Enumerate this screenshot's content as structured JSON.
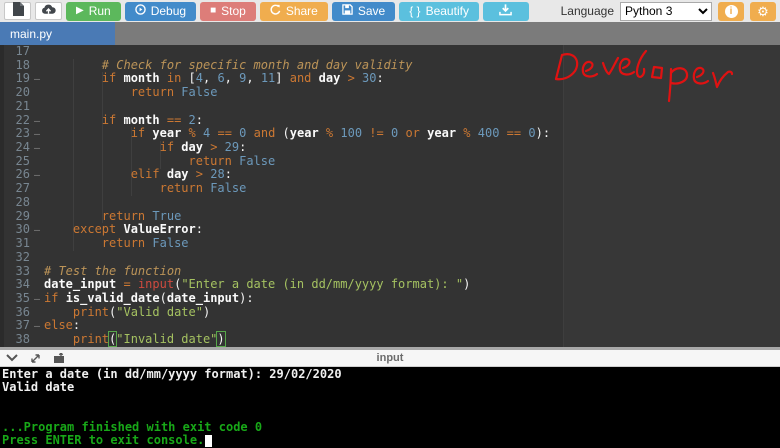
{
  "toolbar": {
    "run_label": "Run",
    "debug_label": "Debug",
    "stop_label": "Stop",
    "share_label": "Share",
    "save_label": "Save",
    "beautify_label": "Beautify",
    "beautify_icon": "{ }",
    "language_label": "Language",
    "language_value": "Python 3"
  },
  "tab": {
    "label": "main.py"
  },
  "annotation": {
    "text": "Developer",
    "color": "#e01212"
  },
  "colors": {
    "run": "#5cb85c",
    "debug": "#428bca",
    "stop": "#dd7d79",
    "share": "#f0ad4e",
    "save": "#428bca",
    "beautify": "#5bc0de",
    "accent_orange": "#f0ad4e",
    "editor_bg": "#333333",
    "keyword": "#cc7833",
    "string": "#a5c261",
    "number": "#6c99bb",
    "comment": "#bc9458",
    "console_green": "#18a818"
  },
  "editor": {
    "lines": [
      {
        "n": 17,
        "fold": false,
        "tokens": []
      },
      {
        "n": 18,
        "fold": false,
        "tokens": [
          [
            "com",
            "        # Check for specific month and day validity"
          ]
        ]
      },
      {
        "n": 19,
        "fold": true,
        "tokens": [
          [
            "sp",
            "        "
          ],
          [
            "kw",
            "if"
          ],
          [
            "sp",
            " "
          ],
          [
            "var",
            "month"
          ],
          [
            "sp",
            " "
          ],
          [
            "kw",
            "in"
          ],
          [
            "sp",
            " ["
          ],
          [
            "num",
            "4"
          ],
          [
            "sp",
            ", "
          ],
          [
            "num",
            "6"
          ],
          [
            "sp",
            ", "
          ],
          [
            "num",
            "9"
          ],
          [
            "sp",
            ", "
          ],
          [
            "num",
            "11"
          ],
          [
            "sp",
            "] "
          ],
          [
            "kw",
            "and"
          ],
          [
            "sp",
            " "
          ],
          [
            "var",
            "day"
          ],
          [
            "sp",
            " "
          ],
          [
            "kw",
            ">"
          ],
          [
            "sp",
            " "
          ],
          [
            "num",
            "30"
          ],
          [
            "sp",
            ":"
          ]
        ]
      },
      {
        "n": 20,
        "fold": false,
        "tokens": [
          [
            "sp",
            "            "
          ],
          [
            "kw",
            "return"
          ],
          [
            "sp",
            " "
          ],
          [
            "num",
            "False"
          ]
        ]
      },
      {
        "n": 21,
        "fold": false,
        "tokens": []
      },
      {
        "n": 22,
        "fold": true,
        "tokens": [
          [
            "sp",
            "        "
          ],
          [
            "kw",
            "if"
          ],
          [
            "sp",
            " "
          ],
          [
            "var",
            "month"
          ],
          [
            "sp",
            " "
          ],
          [
            "kw",
            "=="
          ],
          [
            "sp",
            " "
          ],
          [
            "num",
            "2"
          ],
          [
            "sp",
            ":"
          ]
        ]
      },
      {
        "n": 23,
        "fold": true,
        "tokens": [
          [
            "sp",
            "            "
          ],
          [
            "kw",
            "if"
          ],
          [
            "sp",
            " "
          ],
          [
            "var",
            "year"
          ],
          [
            "sp",
            " "
          ],
          [
            "kw",
            "%"
          ],
          [
            "sp",
            " "
          ],
          [
            "num",
            "4"
          ],
          [
            "sp",
            " "
          ],
          [
            "kw",
            "=="
          ],
          [
            "sp",
            " "
          ],
          [
            "num",
            "0"
          ],
          [
            "sp",
            " "
          ],
          [
            "kw",
            "and"
          ],
          [
            "sp",
            " ("
          ],
          [
            "var",
            "year"
          ],
          [
            "sp",
            " "
          ],
          [
            "kw",
            "%"
          ],
          [
            "sp",
            " "
          ],
          [
            "num",
            "100"
          ],
          [
            "sp",
            " "
          ],
          [
            "kw",
            "!="
          ],
          [
            "sp",
            " "
          ],
          [
            "num",
            "0"
          ],
          [
            "sp",
            " "
          ],
          [
            "kw",
            "or"
          ],
          [
            "sp",
            " "
          ],
          [
            "var",
            "year"
          ],
          [
            "sp",
            " "
          ],
          [
            "kw",
            "%"
          ],
          [
            "sp",
            " "
          ],
          [
            "num",
            "400"
          ],
          [
            "sp",
            " "
          ],
          [
            "kw",
            "=="
          ],
          [
            "sp",
            " "
          ],
          [
            "num",
            "0"
          ],
          [
            "sp",
            "):"
          ]
        ]
      },
      {
        "n": 24,
        "fold": true,
        "tokens": [
          [
            "sp",
            "                "
          ],
          [
            "kw",
            "if"
          ],
          [
            "sp",
            " "
          ],
          [
            "var",
            "day"
          ],
          [
            "sp",
            " "
          ],
          [
            "kw",
            ">"
          ],
          [
            "sp",
            " "
          ],
          [
            "num",
            "29"
          ],
          [
            "sp",
            ":"
          ]
        ]
      },
      {
        "n": 25,
        "fold": false,
        "tokens": [
          [
            "sp",
            "                    "
          ],
          [
            "kw",
            "return"
          ],
          [
            "sp",
            " "
          ],
          [
            "num",
            "False"
          ]
        ]
      },
      {
        "n": 26,
        "fold": true,
        "tokens": [
          [
            "sp",
            "            "
          ],
          [
            "kw",
            "elif"
          ],
          [
            "sp",
            " "
          ],
          [
            "var",
            "day"
          ],
          [
            "sp",
            " "
          ],
          [
            "kw",
            ">"
          ],
          [
            "sp",
            " "
          ],
          [
            "num",
            "28"
          ],
          [
            "sp",
            ":"
          ]
        ]
      },
      {
        "n": 27,
        "fold": false,
        "tokens": [
          [
            "sp",
            "                "
          ],
          [
            "kw",
            "return"
          ],
          [
            "sp",
            " "
          ],
          [
            "num",
            "False"
          ]
        ]
      },
      {
        "n": 28,
        "fold": false,
        "tokens": []
      },
      {
        "n": 29,
        "fold": false,
        "tokens": [
          [
            "sp",
            "        "
          ],
          [
            "kw",
            "return"
          ],
          [
            "sp",
            " "
          ],
          [
            "num",
            "True"
          ]
        ]
      },
      {
        "n": 30,
        "fold": true,
        "tokens": [
          [
            "sp",
            "    "
          ],
          [
            "kw",
            "except"
          ],
          [
            "sp",
            " "
          ],
          [
            "var",
            "ValueError"
          ],
          [
            "sp",
            ":"
          ]
        ]
      },
      {
        "n": 31,
        "fold": false,
        "tokens": [
          [
            "sp",
            "        "
          ],
          [
            "kw",
            "return"
          ],
          [
            "sp",
            " "
          ],
          [
            "num",
            "False"
          ]
        ]
      },
      {
        "n": 32,
        "fold": false,
        "tokens": []
      },
      {
        "n": 33,
        "fold": false,
        "tokens": [
          [
            "com",
            "# Test the function"
          ]
        ]
      },
      {
        "n": 34,
        "fold": false,
        "tokens": [
          [
            "var",
            "date_input"
          ],
          [
            "sp",
            " "
          ],
          [
            "kw",
            "="
          ],
          [
            "sp",
            " "
          ],
          [
            "fn",
            "input"
          ],
          [
            "sp",
            "("
          ],
          [
            "str",
            "\"Enter a date (in dd/mm/yyyy format): \""
          ],
          [
            "sp",
            ")"
          ]
        ]
      },
      {
        "n": 35,
        "fold": true,
        "tokens": [
          [
            "kw",
            "if"
          ],
          [
            "sp",
            " "
          ],
          [
            "var",
            "is_valid_date"
          ],
          [
            "sp",
            "("
          ],
          [
            "var",
            "date_input"
          ],
          [
            "sp",
            "):"
          ]
        ]
      },
      {
        "n": 36,
        "fold": false,
        "tokens": [
          [
            "sp",
            "    "
          ],
          [
            "kw",
            "print"
          ],
          [
            "sp",
            "("
          ],
          [
            "str",
            "\"Valid date\""
          ],
          [
            "sp",
            ")"
          ]
        ]
      },
      {
        "n": 37,
        "fold": true,
        "tokens": [
          [
            "kw",
            "else"
          ],
          [
            "sp",
            ":"
          ]
        ]
      },
      {
        "n": 38,
        "fold": false,
        "tokens": [
          [
            "sp",
            "    "
          ],
          [
            "kw",
            "print"
          ],
          [
            "hl",
            "("
          ],
          [
            "str",
            "\"Invalid date\""
          ],
          [
            "hl",
            ")"
          ]
        ]
      }
    ]
  },
  "console": {
    "panel_label": "input",
    "lines": [
      {
        "text": "Enter a date (in dd/mm/yyyy format): 29/02/2020",
        "color": "white",
        "cursor": false
      },
      {
        "text": "Valid date",
        "color": "white",
        "cursor": false
      },
      {
        "text": "",
        "color": "white",
        "cursor": false
      },
      {
        "text": "",
        "color": "white",
        "cursor": false
      },
      {
        "text": "...Program finished with exit code 0",
        "color": "green",
        "cursor": false
      },
      {
        "text": "Press ENTER to exit console.",
        "color": "green",
        "cursor": true
      }
    ]
  }
}
